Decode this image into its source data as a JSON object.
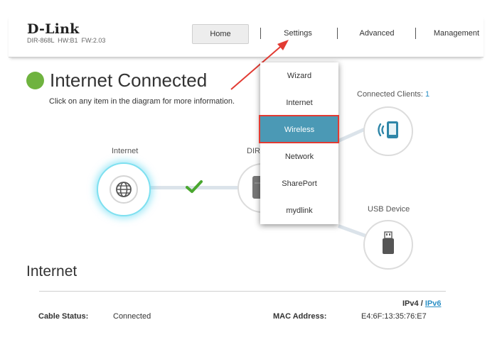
{
  "brand": {
    "logo": "D-Link",
    "model_info": "DIR-868L  HW:B1  FW:2.03"
  },
  "nav": {
    "home": "Home",
    "settings": "Settings",
    "advanced": "Advanced",
    "management": "Management"
  },
  "status": {
    "title": "Internet Connected",
    "hint": "Click on any item in the diagram for more information.",
    "color": "#6fb33f"
  },
  "diagram": {
    "internet_label": "Internet",
    "router_label": "DIR",
    "clients_label": "Connected Clients:",
    "clients_count": "1",
    "usb_label": "USB Device"
  },
  "settings_menu": {
    "items": [
      {
        "label": "Wizard"
      },
      {
        "label": "Internet"
      },
      {
        "label": "Wireless",
        "selected": true
      },
      {
        "label": "Network"
      },
      {
        "label": "SharePort"
      },
      {
        "label": "mydlink"
      }
    ],
    "accent": "#4b99b5",
    "highlight_color": "#e23b33"
  },
  "section": {
    "title": "Internet",
    "ipv4": "IPv4",
    "separator": "/",
    "ipv6": "IPv6",
    "cable_status_label": "Cable Status:",
    "cable_status_value": "Connected",
    "mac_label": "MAC Address:",
    "mac_value": "E4:6F:13:35:76:E7"
  }
}
